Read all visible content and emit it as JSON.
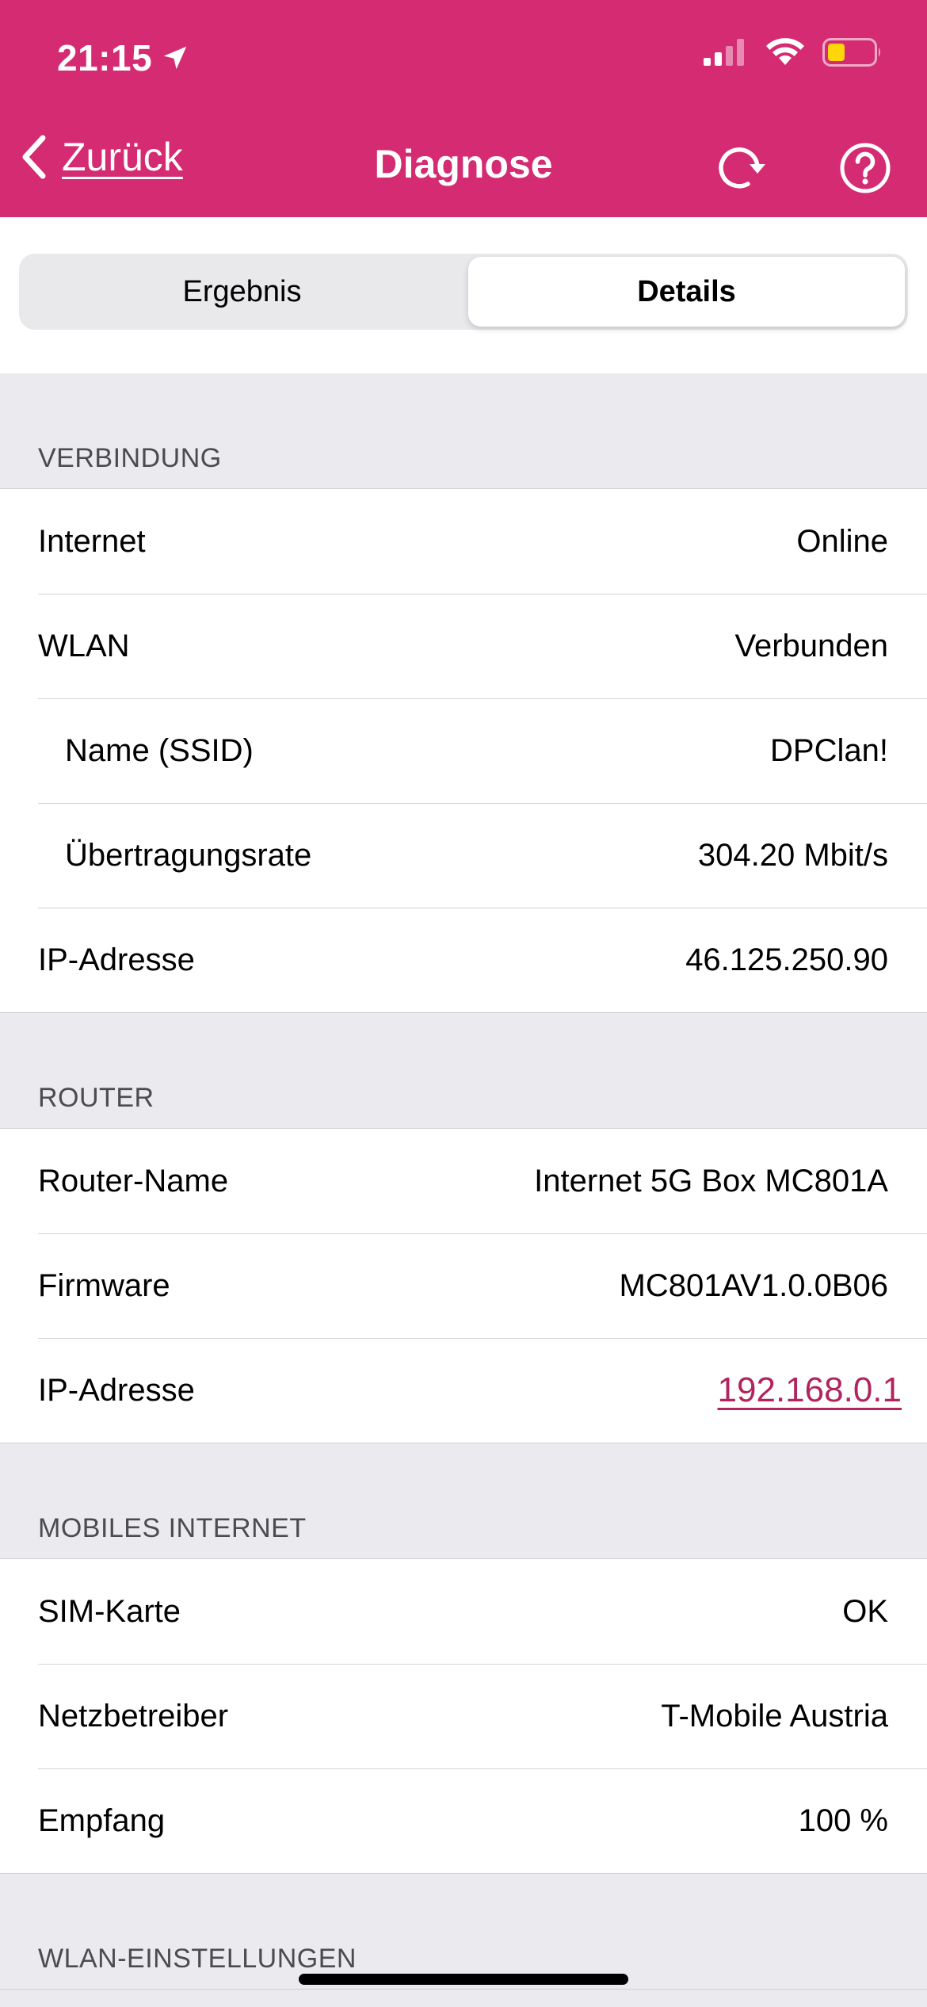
{
  "status_bar": {
    "time": "21:15"
  },
  "nav": {
    "back_label": "Zurück",
    "title": "Diagnose"
  },
  "segments": {
    "left_label": "Ergebnis",
    "right_label": "Details",
    "selected": "Details"
  },
  "sections": [
    {
      "title": "VERBINDUNG",
      "rows": [
        {
          "label": "Internet",
          "value": "Online"
        },
        {
          "label": "WLAN",
          "value": "Verbunden"
        },
        {
          "label": "Name (SSID)",
          "value": "DPClan!"
        },
        {
          "label": "Übertragungsrate",
          "value": "304.20 Mbit/s"
        },
        {
          "label": "IP-Adresse",
          "value": "46.125.250.90"
        }
      ]
    },
    {
      "title": "ROUTER",
      "rows": [
        {
          "label": "Router-Name",
          "value": "Internet 5G Box MC801A"
        },
        {
          "label": "Firmware",
          "value": "MC801AV1.0.0B06"
        },
        {
          "label": "IP-Adresse",
          "value": "192.168.0.1"
        }
      ]
    },
    {
      "title": "MOBILES INTERNET",
      "rows": [
        {
          "label": "SIM-Karte",
          "value": "OK"
        },
        {
          "label": "Netzbetreiber",
          "value": "T-Mobile Austria"
        },
        {
          "label": "Empfang",
          "value": "100 %"
        }
      ]
    },
    {
      "title": "WLAN-EINSTELLUNGEN"
    }
  ],
  "colors": {
    "brand_magenta": "#d42b73",
    "link": "#b0245f",
    "grouped_background": "#ebebef",
    "battery_low": "#ffd60a"
  },
  "icons": {
    "location": "location-arrow-icon",
    "cellular": "cellular-signal-icon",
    "wifi": "wifi-icon",
    "battery": "battery-icon",
    "back": "chevron-left-icon",
    "refresh": "refresh-icon",
    "help": "help-circle-icon"
  }
}
